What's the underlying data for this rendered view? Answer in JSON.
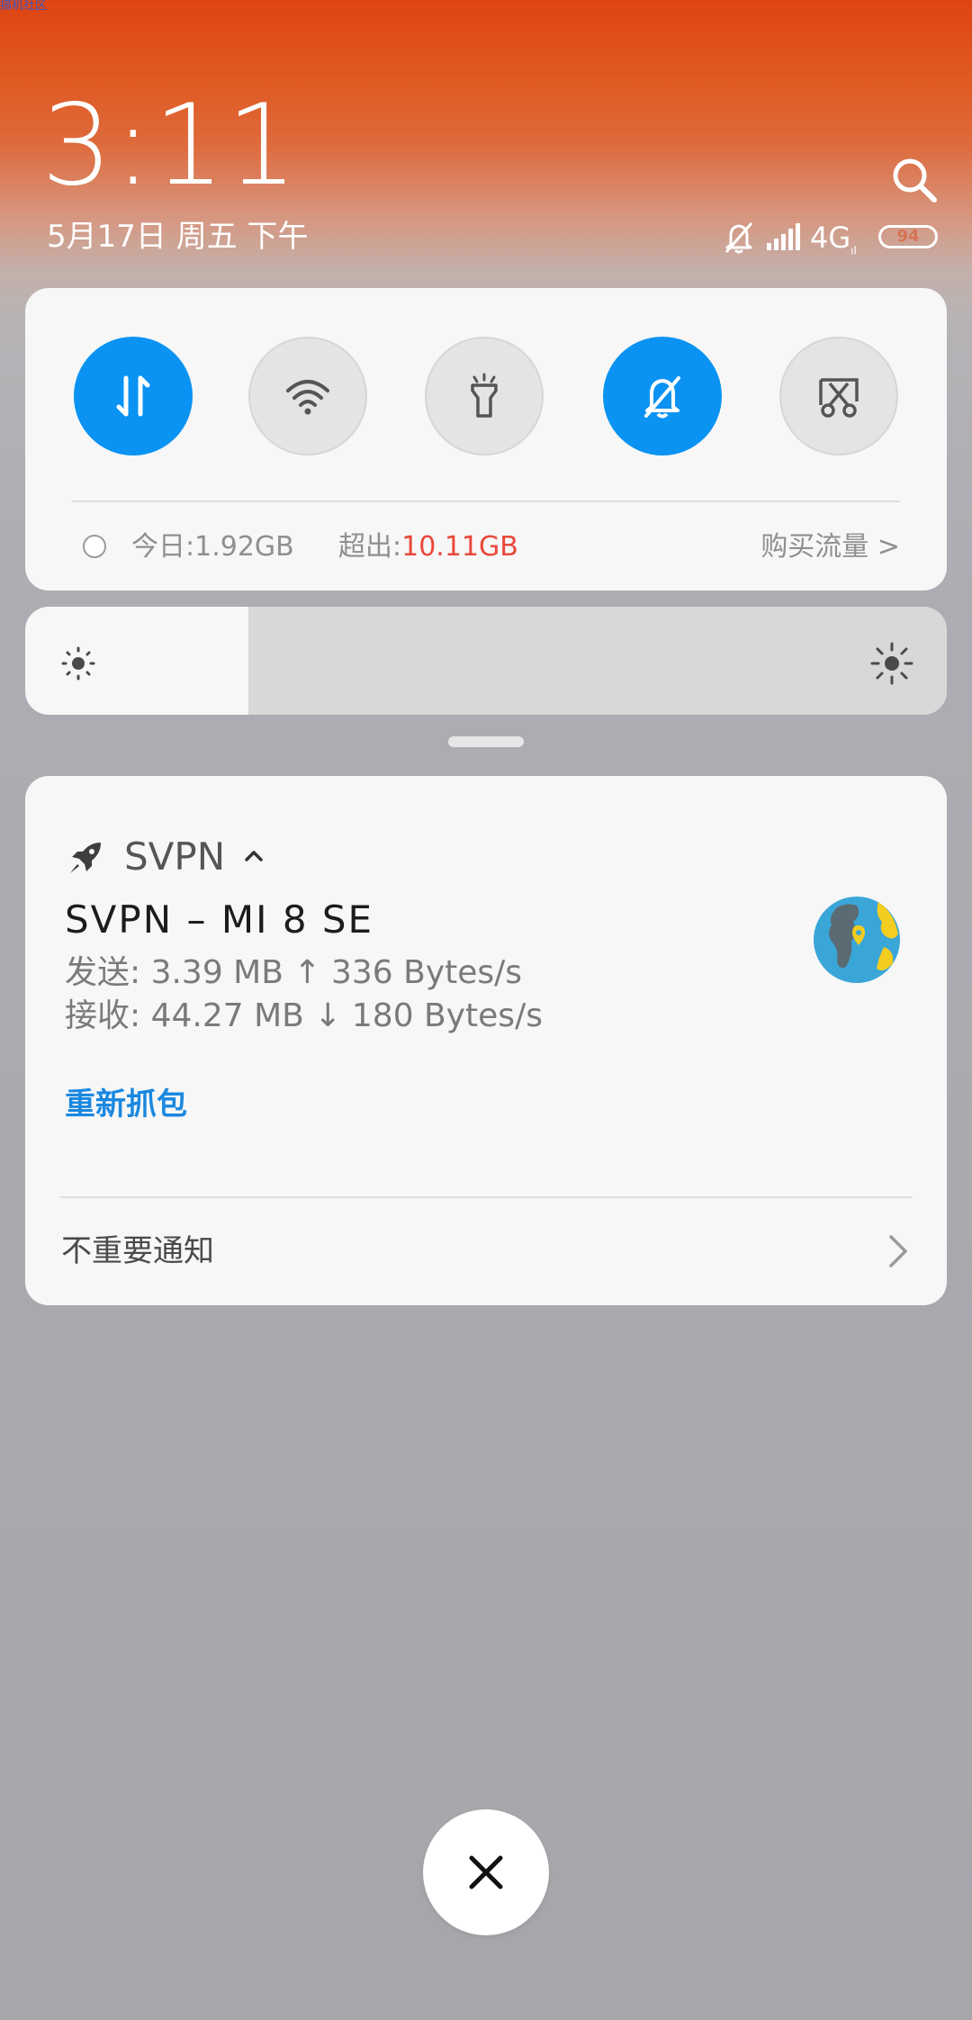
{
  "watermark": "搞机社区",
  "header": {
    "time": "3:11",
    "date": "5月17日 周五 下午",
    "network": "4G",
    "battery": "94"
  },
  "quick_settings": {
    "toggles": [
      {
        "name": "mobile-data",
        "state": "on"
      },
      {
        "name": "wifi",
        "state": "off"
      },
      {
        "name": "flashlight",
        "state": "off"
      },
      {
        "name": "mute",
        "state": "on"
      },
      {
        "name": "screenshot",
        "state": "off"
      }
    ],
    "data_usage": {
      "today_label": "今日:1.92GB",
      "over_label": "超出:",
      "over_value": "10.11GB",
      "buy_label": "购买流量 >"
    }
  },
  "brightness": {
    "level_percent": 22
  },
  "notification": {
    "app_name": "SVPN",
    "title": "SVPN – MI 8 SE",
    "line1": "发送: 3.39 MB ↑ 336 Bytes/s",
    "line2": "接收: 44.27 MB ↓ 180 Bytes/s",
    "action": "重新抓包",
    "unimportant": "不重要通知"
  },
  "colors": {
    "accent_blue": "#0a93f3",
    "over_red": "#e8483a",
    "action_blue": "#1a88e0"
  }
}
